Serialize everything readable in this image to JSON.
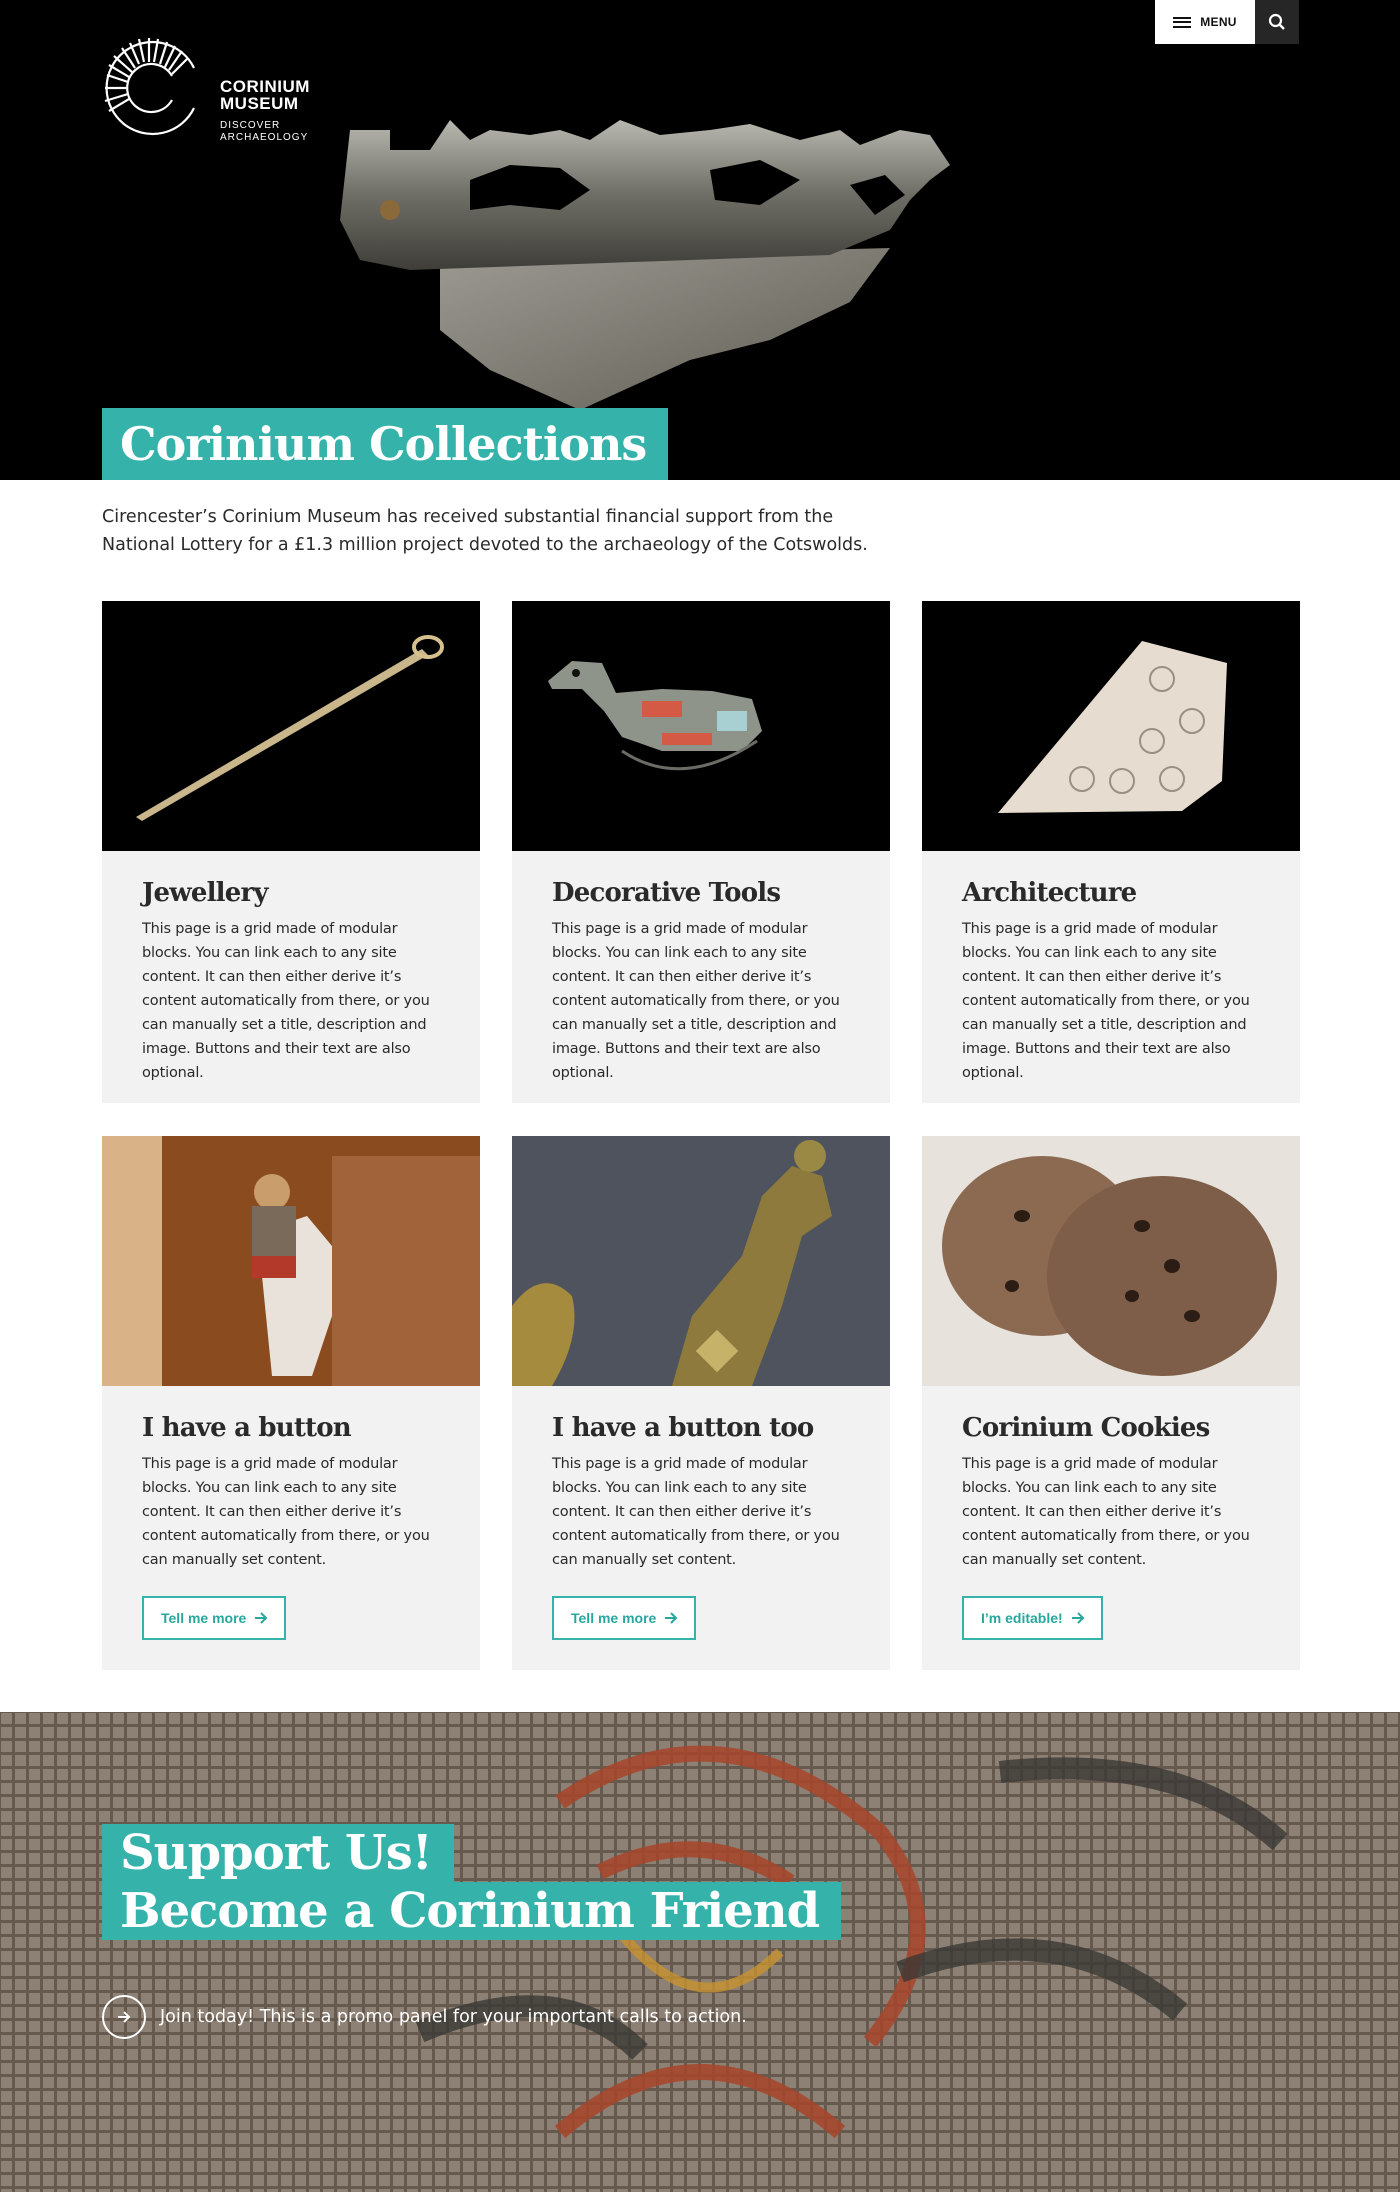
{
  "brand": {
    "name_line1": "CORINIUM",
    "name_line2": "MUSEUM",
    "tagline_line1": "DISCOVER",
    "tagline_line2": "ARCHAEOLOGY"
  },
  "header": {
    "menu_label": "MENU",
    "menu_icon": "hamburger-icon",
    "search_icon": "search-icon"
  },
  "hero": {
    "title": "Corinium Collections",
    "image": "roman-knife-handle-hound"
  },
  "intro": {
    "text": "Cirencester’s Corinium Museum has received substantial financial support from the National Lottery for a £1.3 million project devoted to the archaeology of the Cotswolds."
  },
  "cards": [
    {
      "title": "Jewellery",
      "image": "hairpin",
      "description": "This page is a grid made of modular blocks. You can link each to any site content. It can then either derive it’s content automatically from there, or you can manually set a title, description and image. Buttons and their text are also optional."
    },
    {
      "title": "Decorative Tools",
      "image": "duck-brooch",
      "description": "This page is a grid made of modular blocks. You can link each to any site content. It can then either derive it’s content automatically from there, or you can manually set a title, description and image. Buttons and their text are also optional."
    },
    {
      "title": "Architecture",
      "image": "carved-bone-plaque",
      "description": "This page is a grid made of modular blocks. You can link each to any site content. It can then either derive it’s content automatically from there, or you can manually set a title, description and image. Buttons and their text are also optional."
    },
    {
      "title": "I have a button",
      "image": "roman-cavalry-display",
      "description": "This page is a grid made of modular blocks. You can link each to any site content. It can then either derive it’s content automatically from there, or you can manually set content.",
      "button": "Tell me more"
    },
    {
      "title": "I have a button too",
      "image": "bronze-cockerel",
      "description": "This page is a grid made of modular blocks. You can link each to any site content. It can then either derive it’s content automatically from there, or you can manually set content.",
      "button": "Tell me more"
    },
    {
      "title": "Corinium Cookies",
      "image": "cookies",
      "description": "This page is a grid made of modular blocks. You can link each to any site content. It can then either derive it’s content automatically from there, or you can manually set content.",
      "button": "I’m editable!"
    }
  ],
  "promo": {
    "title_line1": "Support Us!",
    "title_line2": "Become a Corinium Friend",
    "cta": "Join today! This is a promo panel for your important calls to action.",
    "image": "roman-mosaic-face"
  },
  "colors": {
    "accent": "#35b3ab",
    "card_bg": "#f2f2f2",
    "hero_bg": "#000000"
  }
}
